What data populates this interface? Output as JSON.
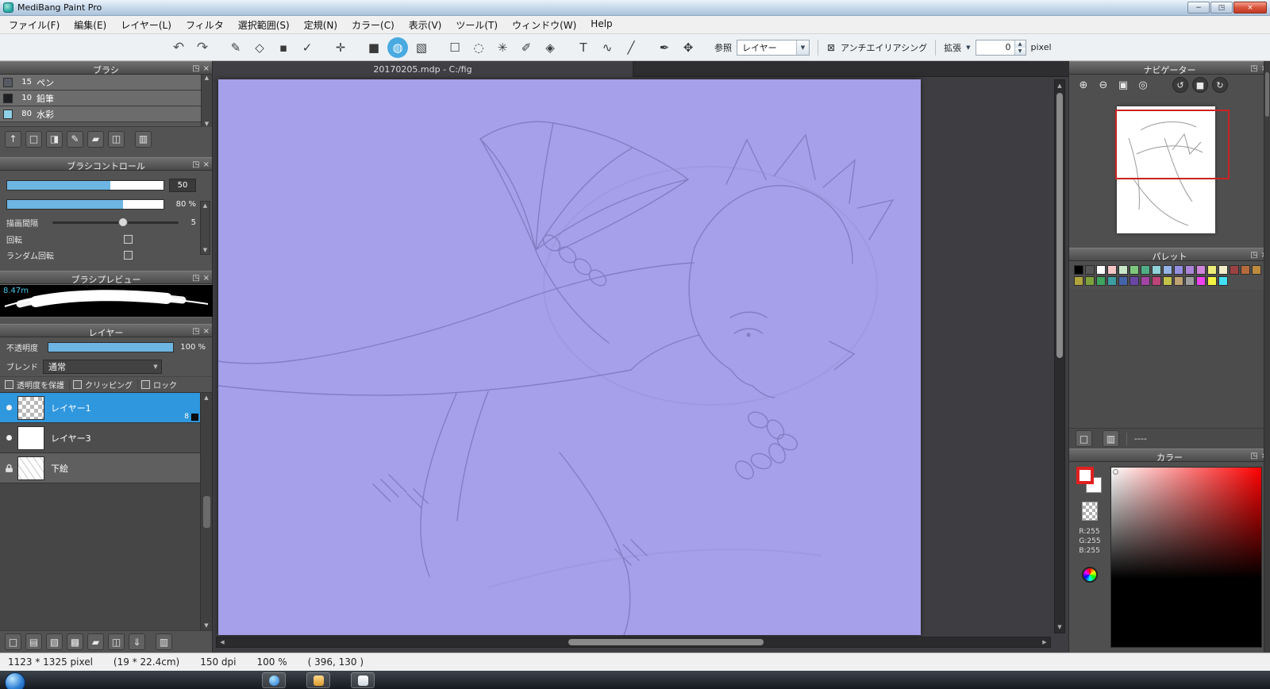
{
  "window": {
    "title": "MediBang Paint Pro",
    "minimize_icon": "−",
    "maximize_icon": "◳",
    "close_icon": "×"
  },
  "menu": {
    "items": [
      "ファイル(F)",
      "編集(E)",
      "レイヤー(L)",
      "フィルタ",
      "選択範囲(S)",
      "定規(N)",
      "カラー(C)",
      "表示(V)",
      "ツール(T)",
      "ウィンドウ(W)",
      "Help"
    ]
  },
  "toolbar": {
    "tools": [
      {
        "name": "undo-button",
        "glyph": "↶"
      },
      {
        "name": "redo-button",
        "glyph": "↷"
      },
      {
        "name": "brush-tool",
        "glyph": "✎"
      },
      {
        "name": "eraser-tool",
        "glyph": "◇"
      },
      {
        "name": "dot-tool",
        "glyph": "▪"
      },
      {
        "name": "shape-brush-tool",
        "glyph": "✓"
      },
      {
        "name": "move-tool",
        "glyph": "✛"
      },
      {
        "name": "fill-tool",
        "glyph": "■"
      },
      {
        "name": "bucket-tool",
        "glyph": "◍",
        "selected": true
      },
      {
        "name": "gradient-tool",
        "glyph": "▧"
      },
      {
        "name": "select-rect-tool",
        "glyph": "☐"
      },
      {
        "name": "select-lasso-tool",
        "glyph": "◌"
      },
      {
        "name": "magic-wand-tool",
        "glyph": "✳"
      },
      {
        "name": "select-pen-tool",
        "glyph": "✐"
      },
      {
        "name": "select-eraser-tool",
        "glyph": "◈"
      },
      {
        "name": "text-tool",
        "glyph": "T"
      },
      {
        "name": "operation-tool",
        "glyph": "∿"
      },
      {
        "name": "divide-tool",
        "glyph": "╱"
      },
      {
        "name": "eyedropper-tool",
        "glyph": "✒"
      },
      {
        "name": "hand-tool",
        "glyph": "✥"
      }
    ],
    "reference_label": "参照",
    "reference_value": "レイヤー",
    "antialias_check_glyph": "⊠",
    "antialias_label": "アンチエイリアシング",
    "expand_label": "拡張",
    "expand_value": "0",
    "expand_unit": "pixel"
  },
  "canvas": {
    "tab_title": "20170205.mdp - C:/fig",
    "background_color": "#a5a0e9"
  },
  "panels": {
    "brush": {
      "title": "ブラシ",
      "brushes": [
        {
          "size": "15",
          "name": "ペン",
          "chip": "#555a63"
        },
        {
          "size": "10",
          "name": "鉛筆",
          "chip": "#1e2024"
        },
        {
          "size": "80",
          "name": "水彩",
          "chip": "#8fd0ea"
        }
      ],
      "icons": [
        {
          "name": "upload-brush-icon",
          "glyph": "↑"
        },
        {
          "name": "add-brush-icon",
          "glyph": "□"
        },
        {
          "name": "add-brush-menu-icon",
          "glyph": "◨"
        },
        {
          "name": "edit-brush-icon",
          "glyph": "✎"
        },
        {
          "name": "brush-folder-icon",
          "glyph": "▰"
        },
        {
          "name": "duplicate-brush-icon",
          "glyph": "◫"
        },
        {
          "name": "delete-brush-icon",
          "glyph": "▥"
        }
      ]
    },
    "brush_control": {
      "title": "ブラシコントロール",
      "size_value": "50",
      "opacity_value": "80 %",
      "interval_label": "描画間隔",
      "interval_value": "5",
      "rotation_label": "回転",
      "random_rotation_label": "ランダム回転"
    },
    "brush_preview": {
      "title": "ブラシプレビュー",
      "size_label": "8.47m"
    },
    "layer": {
      "title": "レイヤー",
      "opacity_label": "不透明度",
      "opacity_value": "100 %",
      "blend_label": "ブレンド",
      "blend_value": "通常",
      "protect_label": "透明度を保護",
      "clip_label": "クリッピング",
      "lock_label": "ロック",
      "layers": [
        {
          "name": "レイヤー1",
          "thumb": "checker",
          "selected": true,
          "badge": "8"
        },
        {
          "name": "レイヤー3",
          "thumb": "plain"
        },
        {
          "name": "下絵",
          "thumb": "sketch",
          "locked": true
        }
      ],
      "icons": [
        {
          "name": "add-layer-icon",
          "glyph": "□"
        },
        {
          "name": "add-8bit-layer-icon",
          "glyph": "▤"
        },
        {
          "name": "add-1bit-layer-icon",
          "glyph": "▧"
        },
        {
          "name": "add-halftone-layer-icon",
          "glyph": "▩"
        },
        {
          "name": "layer-folder-icon",
          "glyph": "▰"
        },
        {
          "name": "duplicate-layer-icon",
          "glyph": "◫"
        },
        {
          "name": "merge-layer-icon",
          "glyph": "⇓"
        },
        {
          "name": "delete-layer-icon",
          "glyph": "▥"
        }
      ]
    },
    "navigator": {
      "title": "ナビゲーター",
      "icons_square": [
        {
          "name": "zoom-in-icon",
          "glyph": "⊕"
        },
        {
          "name": "zoom-out-icon",
          "glyph": "⊖"
        },
        {
          "name": "fit-screen-icon",
          "glyph": "▣"
        },
        {
          "name": "zoom-actual-icon",
          "glyph": "◎"
        }
      ],
      "icons_round": [
        {
          "name": "rotate-ccw-icon",
          "glyph": "↺"
        },
        {
          "name": "reset-rotation-icon",
          "glyph": "■"
        },
        {
          "name": "rotate-cw-icon",
          "glyph": "↻"
        }
      ]
    },
    "palette": {
      "title": "パレット",
      "colors": [
        "#000000",
        "#565656",
        "#ffffff",
        "#f6c6c6",
        "#c9e8c9",
        "#7dc87d",
        "#4fae86",
        "#8fd2d8",
        "#96b3e8",
        "#958fe0",
        "#ab84da",
        "#cf86da",
        "#ecec7a",
        "#f2eccb",
        "#9c4242",
        "#b56a3c",
        "#bd8a3e",
        "#b1a33c",
        "#7da23c",
        "#3ea45e",
        "#3c9ea0",
        "#4464a8",
        "#6a46a4",
        "#a244a4",
        "#bc4478",
        "#c2c24a",
        "#bfa273",
        "#9e9e9e",
        "#ee42ee",
        "#f4f442",
        "#42e0f4"
      ],
      "icons": [
        {
          "name": "add-color-icon",
          "glyph": "□"
        },
        {
          "name": "delete-color-icon",
          "glyph": "▥"
        }
      ],
      "footer_value": "----"
    },
    "color": {
      "title": "カラー",
      "r_label": "R:255",
      "g_label": "G:255",
      "b_label": "B:255",
      "hue": "#ff0000"
    }
  },
  "status": {
    "size": "1123 * 1325 pixel",
    "cm": "(19 * 22.4cm)",
    "dpi": "150 dpi",
    "zoom": "100 %",
    "pos": "( 396, 130 )"
  }
}
